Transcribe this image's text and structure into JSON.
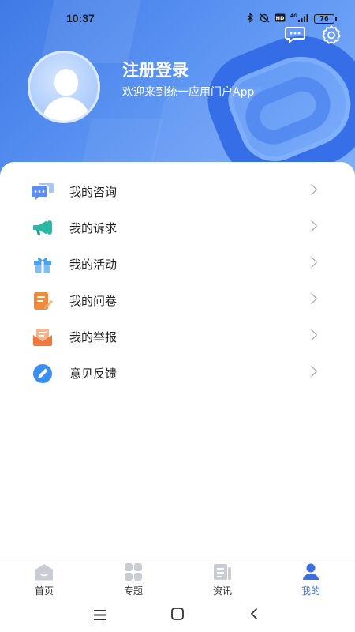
{
  "status_bar": {
    "time": "10:37",
    "icons": [
      "bluetooth-icon",
      "alarm-off-icon",
      "hd-icon",
      "4g-signal-icon"
    ],
    "network": "4G",
    "battery": "76"
  },
  "header": {
    "title": "注册登录",
    "subtitle": "欢迎来到统一应用门户App",
    "background_color": "#4f86ee",
    "accent_color": "#2f68e6"
  },
  "menu": {
    "items": [
      {
        "label": "我的咨询",
        "icon": "consult-chat-icon",
        "color": "#5b8ef0"
      },
      {
        "label": "我的诉求",
        "icon": "megaphone-icon",
        "color": "#2bb8a4"
      },
      {
        "label": "我的活动",
        "icon": "gift-icon",
        "color": "#4aa3f0"
      },
      {
        "label": "我的问卷",
        "icon": "questionnaire-icon",
        "color": "#f08a3c"
      },
      {
        "label": "我的举报",
        "icon": "report-mail-icon",
        "color": "#f0783c"
      },
      {
        "label": "意见反馈",
        "icon": "feedback-pen-icon",
        "color": "#3a8ef0"
      }
    ]
  },
  "tabbar": {
    "tabs": [
      {
        "label": "首页",
        "icon": "home-icon",
        "active": false
      },
      {
        "label": "专题",
        "icon": "topics-grid-icon",
        "active": false
      },
      {
        "label": "资讯",
        "icon": "news-icon",
        "active": false
      },
      {
        "label": "我的",
        "icon": "profile-icon",
        "active": true
      }
    ],
    "active_color": "#3b6fe0",
    "inactive_icon_color": "#c9ccd3"
  },
  "system_nav": {
    "buttons": [
      "menu-icon",
      "home-square-icon",
      "back-icon"
    ]
  }
}
